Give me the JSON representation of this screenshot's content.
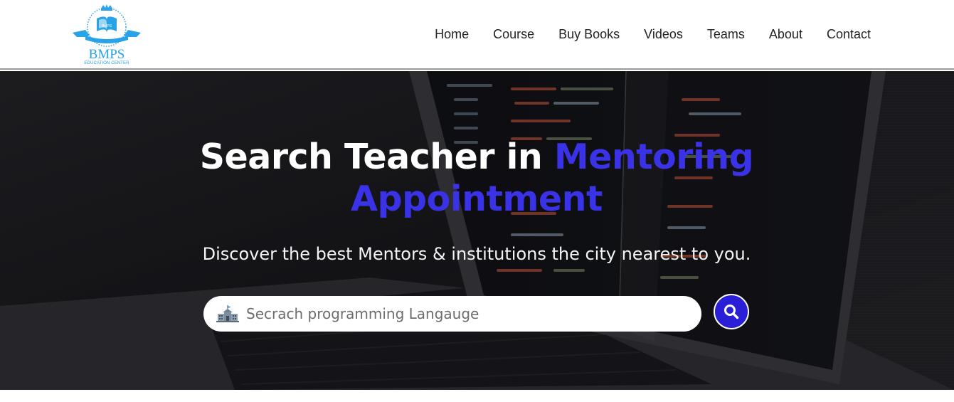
{
  "header": {
    "logo": {
      "name": "BMPS",
      "tagline": "EDUCATION CENTER",
      "book_text": "BMPS"
    },
    "nav": [
      {
        "label": "Home"
      },
      {
        "label": "Course"
      },
      {
        "label": "Buy Books"
      },
      {
        "label": "Videos"
      },
      {
        "label": "Teams"
      },
      {
        "label": "About"
      },
      {
        "label": "Contact"
      }
    ]
  },
  "hero": {
    "title_part1": "Search Teacher in ",
    "title_accent": "Mentoring Appointment",
    "subtitle": "Discover the best Mentors & institutions the city nearest to you.",
    "search": {
      "icon": "school-icon",
      "placeholder": "Secrach programming Langauge",
      "value": ""
    },
    "search_button_icon": "search-icon"
  },
  "colors": {
    "accent": "#3a32e6",
    "button": "#2a1fd6",
    "logo_blue": "#29a3e8"
  }
}
